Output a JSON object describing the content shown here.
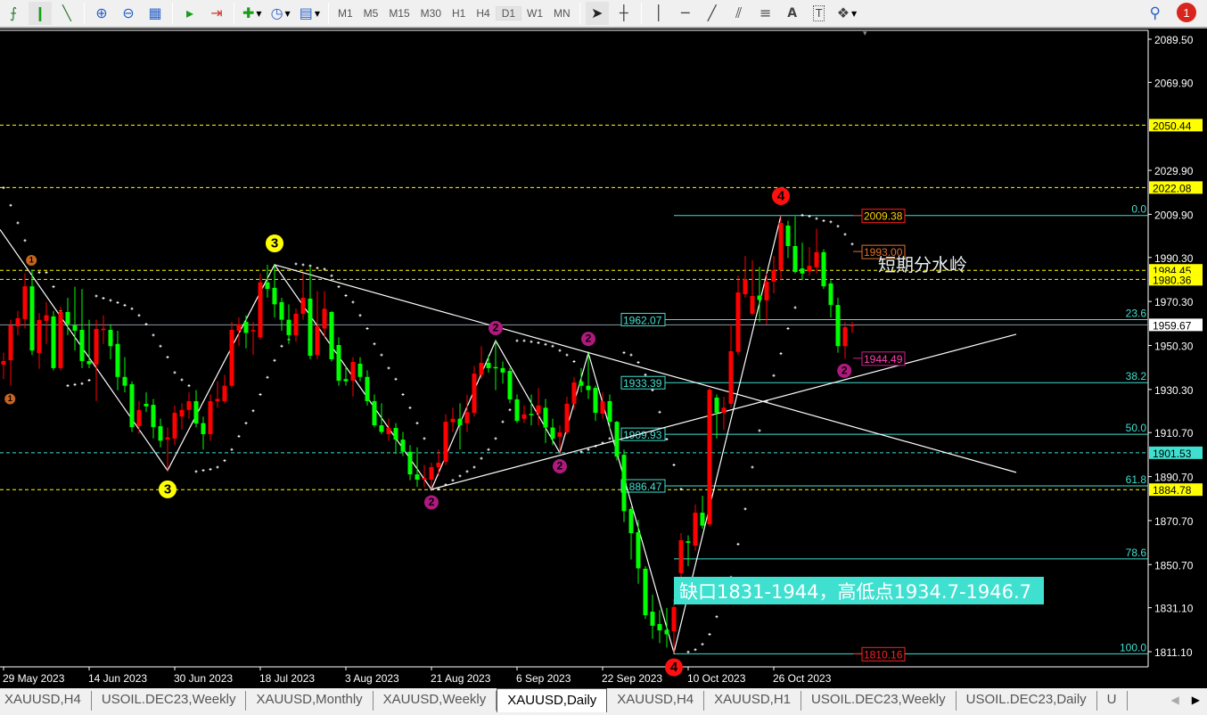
{
  "toolbar": {
    "left_icons": [
      "line-chart-icon",
      "candlestick-chart-icon",
      "area-chart-icon",
      "zoom-in-icon",
      "zoom-out-icon",
      "tile-windows-icon",
      "chart-shift-icon",
      "autoscroll-icon",
      "new-indicator-icon",
      "periods-clock-icon",
      "templates-icon"
    ],
    "timeframes": [
      "M1",
      "M5",
      "M15",
      "M30",
      "H1",
      "H4",
      "D1",
      "W1",
      "MN"
    ],
    "active_timeframe": "D1",
    "tools": [
      "cursor-icon",
      "crosshair-icon",
      "vertical-line-icon",
      "horizontal-line-icon",
      "trendline-icon",
      "equidistant-channel-icon",
      "fibonacci-icon",
      "text-icon",
      "text-label-icon",
      "shapes-icon"
    ],
    "text_tool_label": "A",
    "notification_count": "1"
  },
  "chart_data": {
    "type": "candlestick",
    "symbol_tab": "XAUUSD,Daily",
    "up_color": "#ff0000",
    "down_color": "#00ff00",
    "ylim": [
      1803.5,
      2093.5
    ],
    "price_ticks": [
      "2089.50",
      "2069.90",
      "2029.90",
      "2009.90",
      "1990.30",
      "1970.30",
      "1950.30",
      "1930.30",
      "1910.70",
      "1890.70",
      "1870.70",
      "1850.70",
      "1831.10",
      "1811.10"
    ],
    "date_labels": [
      {
        "bar": 0,
        "label": "29 May 2023"
      },
      {
        "bar": 12,
        "label": "14 Jun 2023"
      },
      {
        "bar": 24,
        "label": "30 Jun 2023"
      },
      {
        "bar": 36,
        "label": "18 Jul 2023"
      },
      {
        "bar": 48,
        "label": "3 Aug 2023"
      },
      {
        "bar": 60,
        "label": "21 Aug 2023"
      },
      {
        "bar": 72,
        "label": "6 Sep 2023"
      },
      {
        "bar": 84,
        "label": "22 Sep 2023"
      },
      {
        "bar": 96,
        "label": "10 Oct 2023"
      },
      {
        "bar": 108,
        "label": "26 Oct 2023"
      }
    ],
    "candles": [
      [
        1941.6,
        1947,
        1935,
        1943.2
      ],
      [
        1943.6,
        1962,
        1932,
        1959.4
      ],
      [
        1959,
        1966,
        1955,
        1962.7
      ],
      [
        1962.3,
        1983,
        1958,
        1977.2
      ],
      [
        1977.2,
        1984.6,
        1946,
        1948
      ],
      [
        1946.9,
        1965,
        1939.7,
        1961.9
      ],
      [
        1961.5,
        1970,
        1951,
        1964
      ],
      [
        1963.5,
        1966,
        1939,
        1940
      ],
      [
        1940,
        1968,
        1939,
        1965.5
      ],
      [
        1965.5,
        1972,
        1955,
        1960
      ],
      [
        1959.5,
        1977,
        1948,
        1957
      ],
      [
        1957.4,
        1976,
        1940,
        1943.2
      ],
      [
        1943.2,
        1962,
        1940,
        1941.8
      ],
      [
        1941.6,
        1962,
        1925,
        1957.8
      ],
      [
        1957.5,
        1964,
        1951,
        1957.9
      ],
      [
        1957.4,
        1960,
        1944,
        1950
      ],
      [
        1951,
        1957,
        1930,
        1936
      ],
      [
        1936,
        1945,
        1929,
        1932
      ],
      [
        1932.7,
        1934,
        1911,
        1913.2
      ],
      [
        1913.6,
        1925,
        1910,
        1921
      ],
      [
        1923.8,
        1929,
        1920,
        1922.6
      ],
      [
        1923.3,
        1926,
        1908,
        1913.2
      ],
      [
        1913.6,
        1917,
        1904,
        1907
      ],
      [
        1907.6,
        1913,
        1893.5,
        1908.5
      ],
      [
        1908,
        1923,
        1905,
        1919.7
      ],
      [
        1918,
        1924,
        1912,
        1921
      ],
      [
        1921,
        1929,
        1917,
        1925
      ],
      [
        1925,
        1930,
        1913,
        1914.8
      ],
      [
        1915,
        1918,
        1903,
        1910
      ],
      [
        1910,
        1928,
        1907,
        1925
      ],
      [
        1925,
        1934,
        1922,
        1926
      ],
      [
        1925,
        1937,
        1924,
        1932
      ],
      [
        1932,
        1961,
        1931,
        1957.4
      ],
      [
        1957,
        1963,
        1950,
        1960
      ],
      [
        1961,
        1964,
        1949,
        1956
      ],
      [
        1957,
        1961,
        1946,
        1957.3
      ],
      [
        1954,
        1983,
        1953,
        1979
      ],
      [
        1979,
        1987,
        1972,
        1976
      ],
      [
        1976.5,
        1987,
        1963,
        1969
      ],
      [
        1970,
        1972,
        1957,
        1962
      ],
      [
        1962,
        1969,
        1951,
        1955
      ],
      [
        1955,
        1967,
        1952,
        1964.7
      ],
      [
        1964.7,
        1983,
        1962,
        1972
      ],
      [
        1971.6,
        1986,
        1944,
        1945.6
      ],
      [
        1946,
        1975,
        1944,
        1959
      ],
      [
        1958,
        1975,
        1954,
        1967
      ],
      [
        1965.5,
        1966,
        1943,
        1944
      ],
      [
        1950.5,
        1954,
        1932,
        1934.3
      ],
      [
        1935,
        1941,
        1932,
        1934
      ],
      [
        1934.3,
        1945,
        1927,
        1942.8
      ],
      [
        1942,
        1945,
        1934,
        1936
      ],
      [
        1936,
        1939,
        1923,
        1925
      ],
      [
        1925,
        1928,
        1913,
        1914
      ],
      [
        1914,
        1924,
        1910,
        1911
      ],
      [
        1910,
        1917,
        1907,
        1912.8
      ],
      [
        1912.8,
        1915,
        1901,
        1907.5
      ],
      [
        1907.5,
        1911,
        1900,
        1902
      ],
      [
        1902,
        1905,
        1889,
        1891.7
      ],
      [
        1891.7,
        1904,
        1886,
        1889.3
      ],
      [
        1889.3,
        1896,
        1886,
        1890
      ],
      [
        1889.3,
        1897,
        1884.9,
        1895
      ],
      [
        1895,
        1903,
        1891,
        1897
      ],
      [
        1897.4,
        1919,
        1896,
        1915.6
      ],
      [
        1915.4,
        1922,
        1911,
        1917
      ],
      [
        1917,
        1924,
        1903,
        1914
      ],
      [
        1915,
        1928,
        1911,
        1920
      ],
      [
        1919.7,
        1941,
        1918,
        1937.5
      ],
      [
        1937,
        1950,
        1935,
        1942.4
      ],
      [
        1942.4,
        1946,
        1938,
        1940
      ],
      [
        1940.5,
        1952.5,
        1930,
        1940
      ],
      [
        1940,
        1943,
        1933,
        1938
      ],
      [
        1938.7,
        1940,
        1924,
        1925.8
      ],
      [
        1925.8,
        1928,
        1915,
        1916
      ],
      [
        1917,
        1923,
        1915,
        1919
      ],
      [
        1919.2,
        1928,
        1914,
        1919
      ],
      [
        1919.5,
        1931,
        1914,
        1923
      ],
      [
        1922,
        1926,
        1906,
        1913
      ],
      [
        1913,
        1917,
        1905,
        1908
      ],
      [
        1908.8,
        1914,
        1901.5,
        1910.8
      ],
      [
        1910.8,
        1927,
        1910,
        1923.8
      ],
      [
        1923.8,
        1936,
        1921,
        1933.5
      ],
      [
        1934,
        1940,
        1929,
        1932
      ],
      [
        1932,
        1946.9,
        1926,
        1930
      ],
      [
        1931,
        1932,
        1916,
        1919.7
      ],
      [
        1919.3,
        1929,
        1917,
        1924.9
      ],
      [
        1925,
        1928,
        1912,
        1915.6
      ],
      [
        1915.6,
        1916,
        1898,
        1899.8
      ],
      [
        1900.6,
        1903,
        1870,
        1875
      ],
      [
        1876,
        1877,
        1853,
        1865
      ],
      [
        1865.4,
        1871,
        1842,
        1849
      ],
      [
        1848.8,
        1850,
        1826,
        1827.7
      ],
      [
        1829.3,
        1837,
        1817,
        1822.9
      ],
      [
        1823.7,
        1830,
        1815,
        1820.8
      ],
      [
        1821,
        1831,
        1813,
        1819
      ],
      [
        1820.4,
        1835,
        1810.7,
        1831.4
      ],
      [
        1846.8,
        1865,
        1842,
        1861.8
      ],
      [
        1861.3,
        1864,
        1850,
        1860.6
      ],
      [
        1859.3,
        1878,
        1857,
        1874.3
      ],
      [
        1874.3,
        1882,
        1867,
        1868.4
      ],
      [
        1869,
        1931,
        1868,
        1930.2
      ],
      [
        1926.6,
        1928,
        1908,
        1919.7
      ],
      [
        1919.7,
        1927,
        1912,
        1922
      ],
      [
        1923.8,
        1960,
        1922,
        1947.7
      ],
      [
        1947.4,
        1982,
        1946,
        1974.4
      ],
      [
        1973.6,
        1991,
        1972,
        1980.5
      ],
      [
        1964.7,
        1989,
        1964,
        1972.8
      ],
      [
        1973,
        1986,
        1961,
        1971
      ],
      [
        1970.8,
        1983,
        1960,
        1979.3
      ],
      [
        1979.3,
        1991,
        1974,
        1984.5
      ],
      [
        1984.5,
        2009.3,
        1980,
        2006
      ],
      [
        2004.8,
        2007,
        1990,
        1995.5
      ],
      [
        1995.5,
        2009,
        1983,
        1983.7
      ],
      [
        1985.3,
        1997,
        1980,
        1983
      ],
      [
        1984,
        1995,
        1982,
        1986.5
      ],
      [
        1985.8,
        2003.4,
        1983,
        1992.7
      ],
      [
        1992.7,
        1994,
        1976,
        1977.2
      ],
      [
        1978.5,
        1980,
        1963,
        1968.7
      ],
      [
        1968.7,
        1972,
        1947,
        1950
      ],
      [
        1950,
        1961,
        1944.4,
        1958.6
      ],
      [
        1959.4,
        1961,
        1956,
        1959.67
      ]
    ],
    "parabolic_sar": [
      2022,
      2014,
      2006,
      1998,
      1990,
      1983.5,
      1983.5,
      1977,
      1966,
      1932,
      1932.5,
      1933,
      1934.5,
      1972.8,
      1971.8,
      1970.8,
      1969.8,
      1968.6,
      1967,
      1964,
      1960,
      1955,
      1950,
      1945,
      1938,
      1934.7,
      1932,
      1893,
      1893.5,
      1894,
      1895,
      1898,
      1903,
      1909,
      1915,
      1920.6,
      1928,
      1935.8,
      1943.5,
      1950,
      1953,
      1987.4,
      1987,
      1986.5,
      1985.5,
      1985,
      1982,
      1977,
      1973,
      1970,
      1964,
      1958,
      1951,
      1946,
      1940,
      1935,
      1928,
      1922,
      1915,
      1908,
      1884.9,
      1885,
      1887,
      1889,
      1891,
      1893,
      1895,
      1899,
      1903,
      1908,
      1915.6,
      1921,
      1952.5,
      1952.5,
      1952,
      1951.5,
      1950.8,
      1950,
      1948,
      1946,
      1943,
      1902,
      1903,
      1904.5,
      1906,
      1908,
      1910,
      1947,
      1946,
      1942.6,
      1937,
      1930,
      1920,
      1907.7,
      1896,
      1885,
      1811,
      1812,
      1814.5,
      1819,
      1827,
      1836,
      1845,
      1860,
      1876,
      1895,
      1911.6,
      1925,
      1936.6,
      1946.6,
      1958,
      1967.5,
      2009.5,
      2009,
      2008,
      2007,
      2006.5,
      2004.5,
      2000.8,
      1996.4
    ],
    "zigzag": [
      [
        -0.5,
        2003
      ],
      [
        23,
        1893.5
      ],
      [
        38,
        1987
      ],
      [
        60,
        1884.9
      ],
      [
        69,
        1952.5
      ],
      [
        78,
        1901.5
      ],
      [
        82,
        1946.9
      ],
      [
        94,
        1810.7
      ],
      [
        109,
        2009.3
      ]
    ],
    "trendlines": [
      {
        "name": "descending-trendline",
        "from": [
          38,
          1987
        ],
        "to": [
          142,
          1892.6
        ]
      },
      {
        "name": "ascending-trendline",
        "from": [
          60,
          1884.9
        ],
        "to": [
          142,
          1955.4
        ]
      }
    ],
    "horizontal_lines": [
      {
        "price": 2050.44,
        "label": "2050.44",
        "color": "#ffff00",
        "tag_bg": "#ffff00",
        "tag_fg": "#000000",
        "dashed": true
      },
      {
        "price": 2022.08,
        "label": "2022.08",
        "color": "#ffff00",
        "tag_bg": "#ffff00",
        "tag_fg": "#000000",
        "dashed": true
      },
      {
        "price": 1984.45,
        "label": "1984.45",
        "color": "#ffff00",
        "tag_bg": "#ffff00",
        "tag_fg": "#000000",
        "dashed": true
      },
      {
        "price": 1980.36,
        "label": "1980.36",
        "color": "#ffff00",
        "tag_bg": "#ffff00",
        "tag_fg": "#000000",
        "dashed": true
      },
      {
        "price": 1959.67,
        "label": "1959.67",
        "color": "#8a97a3",
        "tag_bg": "#ffffff",
        "tag_fg": "#000000",
        "dashed": false
      },
      {
        "price": 1901.53,
        "label": "1901.53",
        "color": "#40e0d0",
        "tag_bg": "#40e0d0",
        "tag_fg": "#000000",
        "dashed": true
      },
      {
        "price": 1884.78,
        "label": "1884.78",
        "color": "#ffff00",
        "tag_bg": "#ffff00",
        "tag_fg": "#000000",
        "dashed": true
      }
    ],
    "fibonacci": {
      "color": "#40e0d0",
      "start_bar": 94,
      "levels": [
        {
          "ratio": "0.0",
          "price": 2009.38,
          "box": ""
        },
        {
          "ratio": "23.6",
          "price": 1962.07,
          "box": "1962.07"
        },
        {
          "ratio": "38.2",
          "price": 1933.39,
          "box": "1933.39"
        },
        {
          "ratio": "50.0",
          "price": 1909.93,
          "box": "1909.93"
        },
        {
          "ratio": "61.8",
          "price": 1886.47,
          "box": "1886.47"
        },
        {
          "ratio": "78.6",
          "price": 1853.3,
          "box": ""
        },
        {
          "ratio": "100.0",
          "price": 1810.16,
          "box": ""
        }
      ]
    },
    "price_tags": [
      {
        "price": 2009.38,
        "label": "2009.38",
        "color": "#ff2020",
        "fg": "#ffd000"
      },
      {
        "price": 1993.0,
        "label": "1993.00",
        "color": "#e0702a",
        "fg": "#e0702a"
      },
      {
        "price": 1944.49,
        "label": "1944.49",
        "color": "#d0208a",
        "fg": "#ff40b0"
      },
      {
        "price": 1810.16,
        "label": "1810.16",
        "color": "#ff2020",
        "fg": "#ff2020"
      }
    ],
    "wave_markers": [
      {
        "bar": 3.9,
        "price": 1989,
        "label": "1",
        "color": "#c8641e",
        "size": "small"
      },
      {
        "bar": 0.9,
        "price": 1926,
        "label": "1",
        "color": "#c8641e",
        "size": "small"
      },
      {
        "bar": 38,
        "price": 1996.7,
        "label": "3",
        "color": "#ffff00",
        "size": "big"
      },
      {
        "bar": 23,
        "price": 1884.9,
        "label": "3",
        "color": "#ffff00",
        "size": "big"
      },
      {
        "bar": 69,
        "price": 1958.2,
        "label": "2",
        "color": "#b0197e",
        "size": "mid"
      },
      {
        "bar": 60,
        "price": 1879,
        "label": "2",
        "color": "#b0197e",
        "size": "mid"
      },
      {
        "bar": 82,
        "price": 1953.3,
        "label": "2",
        "color": "#b0197e",
        "size": "mid"
      },
      {
        "bar": 78,
        "price": 1895.4,
        "label": "2",
        "color": "#b0197e",
        "size": "mid"
      },
      {
        "bar": 117.9,
        "price": 1938.8,
        "label": "2",
        "color": "#b0197e",
        "size": "mid"
      },
      {
        "bar": 109,
        "price": 2018.2,
        "label": "4",
        "color": "#ff1010",
        "size": "big"
      },
      {
        "bar": 94,
        "price": 1804,
        "label": "4",
        "color": "#ff1010",
        "size": "big"
      }
    ]
  },
  "annotations": {
    "watershed": "短期分水岭",
    "gap_note": "缺口1831-1944，高低点1934.7-1946.7"
  },
  "tabs": [
    {
      "label": "XAUUSD,H4",
      "active": false
    },
    {
      "label": "USOIL.DEC23,Weekly",
      "active": false
    },
    {
      "label": "XAUUSD,Monthly",
      "active": false
    },
    {
      "label": "XAUUSD,Weekly",
      "active": false
    },
    {
      "label": "XAUUSD,Daily",
      "active": true
    },
    {
      "label": "XAUUSD,H4",
      "active": false
    },
    {
      "label": "XAUUSD,H1",
      "active": false
    },
    {
      "label": "USOIL.DEC23,Weekly",
      "active": false
    },
    {
      "label": "USOIL.DEC23,Daily",
      "active": false
    },
    {
      "label": "U",
      "active": false
    }
  ]
}
